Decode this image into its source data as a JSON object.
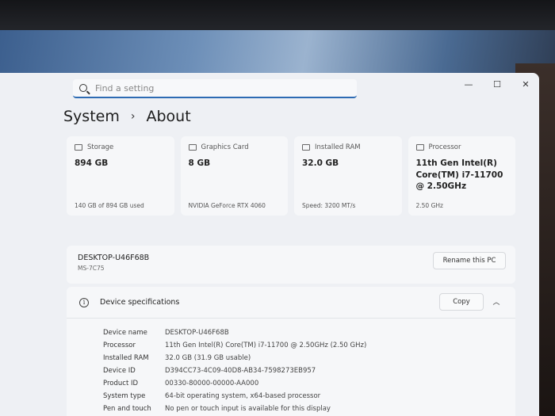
{
  "search": {
    "placeholder": "Find a setting"
  },
  "window": {
    "minimize": "—",
    "maximize": "☐",
    "close": "✕"
  },
  "breadcrumb": {
    "parent": "System",
    "separator": "›",
    "current": "About"
  },
  "cards": [
    {
      "label": "Storage",
      "value": "894 GB",
      "footer": "140 GB of 894 GB used"
    },
    {
      "label": "Graphics Card",
      "value": "8 GB",
      "footer": "NVIDIA GeForce RTX 4060"
    },
    {
      "label": "Installed RAM",
      "value": "32.0 GB",
      "footer": "Speed: 3200 MT/s"
    },
    {
      "label": "Processor",
      "value": "11th Gen Intel(R) Core(TM) i7-11700 @ 2.50GHz",
      "footer": "2.50 GHz"
    }
  ],
  "device": {
    "name": "DESKTOP-U46F68B",
    "model": "MS-7C75",
    "rename_label": "Rename this PC"
  },
  "specs": {
    "title": "Device specifications",
    "copy_label": "Copy",
    "rows": [
      {
        "label": "Device name",
        "value": "DESKTOP-U46F68B"
      },
      {
        "label": "Processor",
        "value": "11th Gen Intel(R) Core(TM) i7-11700 @ 2.50GHz (2.50 GHz)"
      },
      {
        "label": "Installed RAM",
        "value": "32.0 GB (31.9 GB usable)"
      },
      {
        "label": "Device ID",
        "value": "D394CC73-4C09-40D8-AB34-7598273EB957"
      },
      {
        "label": "Product ID",
        "value": "00330-80000-00000-AA000"
      },
      {
        "label": "System type",
        "value": "64-bit operating system, x64-based processor"
      },
      {
        "label": "Pen and touch",
        "value": "No pen or touch input is available for this display"
      }
    ]
  },
  "colors": {
    "accent": "#2d6bb3",
    "window_bg": "#eef0f4",
    "card_bg": "#f6f7f9"
  }
}
